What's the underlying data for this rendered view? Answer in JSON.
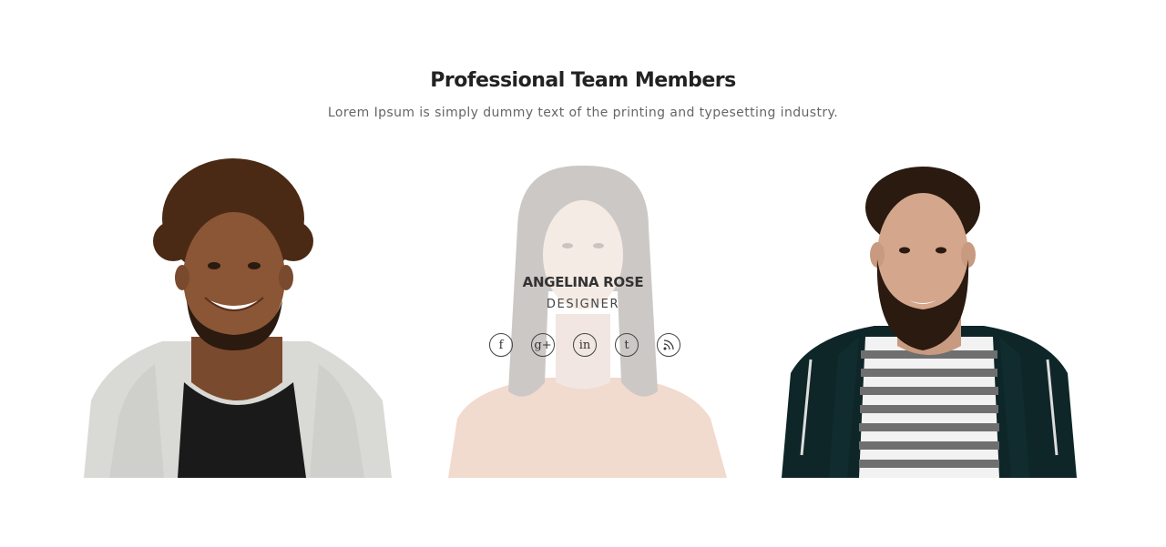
{
  "section": {
    "title": "Professional Team Members",
    "subtitle": "Lorem Ipsum is simply dummy text of the printing and typesetting industry."
  },
  "members": [
    {
      "photo": "smiling man with afro in grey cardigan"
    },
    {
      "photo": "woman with long dark hair in peach top",
      "name": "ANGELINA ROSE",
      "role": "DESIGNER",
      "socials": [
        {
          "icon": "facebook-icon",
          "glyph": "f"
        },
        {
          "icon": "google-plus-icon",
          "glyph": "g+"
        },
        {
          "icon": "linkedin-icon",
          "glyph": "in"
        },
        {
          "icon": "tumblr-icon",
          "glyph": "t"
        },
        {
          "icon": "rss-icon",
          "glyph": ""
        }
      ]
    },
    {
      "photo": "bearded man in striped shirt and dark hoodie"
    }
  ],
  "colors": {
    "title": "#222222",
    "subtitle": "#666666",
    "overlay_text": "#333333"
  }
}
